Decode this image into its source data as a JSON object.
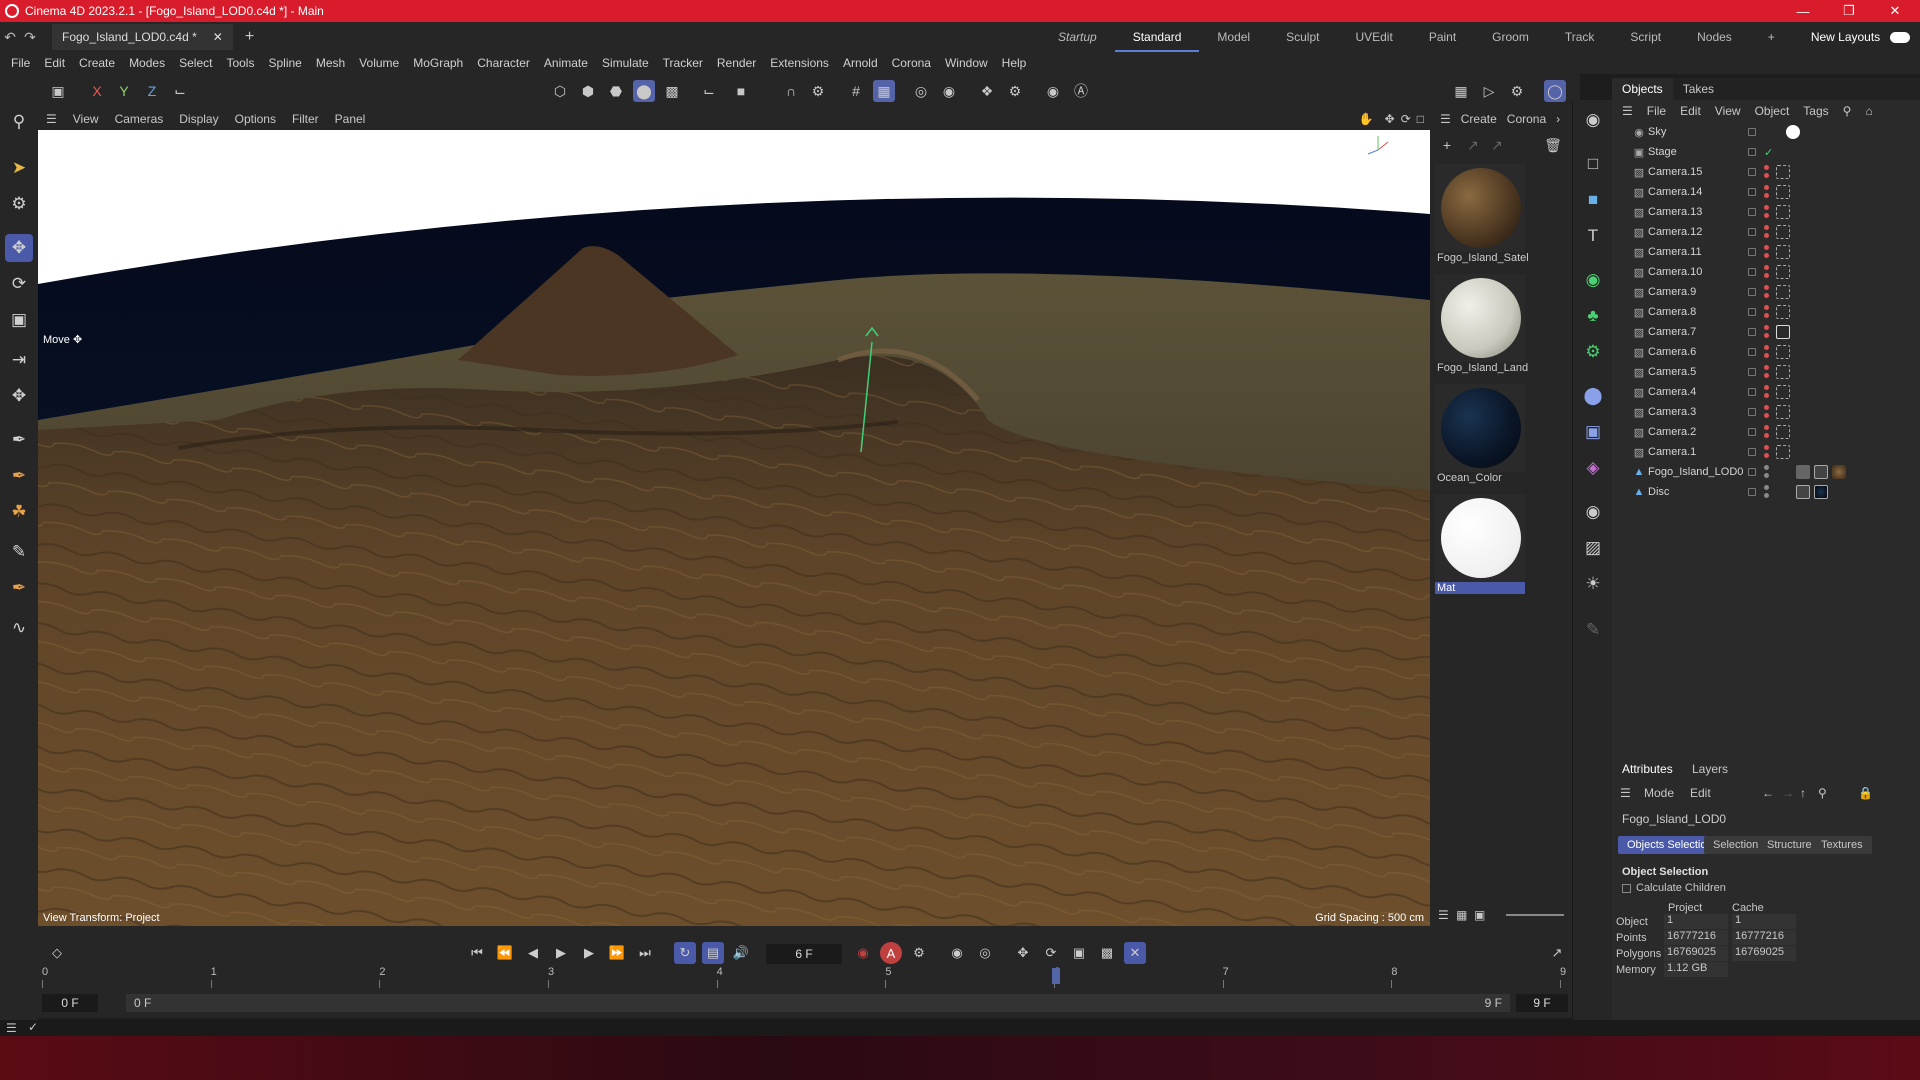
{
  "app": {
    "title": "Cinema 4D 2023.2.1 - [Fogo_Island_LOD0.c4d *] - Main"
  },
  "document": {
    "tab": "Fogo_Island_LOD0.c4d *"
  },
  "layouts": {
    "items": [
      "Startup",
      "Standard",
      "Model",
      "Sculpt",
      "UVEdit",
      "Paint",
      "Groom",
      "Track",
      "Script",
      "Nodes"
    ],
    "active": "Standard",
    "new_layouts": "New Layouts"
  },
  "menu": {
    "items": [
      "File",
      "Edit",
      "Create",
      "Modes",
      "Select",
      "Tools",
      "Spline",
      "Mesh",
      "Volume",
      "MoGraph",
      "Character",
      "Animate",
      "Simulate",
      "Tracker",
      "Render",
      "Extensions",
      "Arnold",
      "Corona",
      "Window",
      "Help"
    ]
  },
  "axes": {
    "x": "X",
    "y": "Y",
    "z": "Z"
  },
  "viewport": {
    "menu": [
      "View",
      "Cameras",
      "Display",
      "Options",
      "Filter",
      "Panel"
    ],
    "mode_label": "Move",
    "view_transform": "View Transform: Project",
    "grid_spacing": "Grid Spacing : 500 cm"
  },
  "materials": {
    "menu": [
      "Create",
      "Corona"
    ],
    "items": [
      {
        "name": "Fogo_Island_Satel"
      },
      {
        "name": "Fogo_Island_Land"
      },
      {
        "name": "Ocean_Color"
      },
      {
        "name": "Mat"
      }
    ]
  },
  "objects": {
    "tabs": [
      "Objects",
      "Takes"
    ],
    "menu": [
      "File",
      "Edit",
      "View",
      "Object",
      "Tags"
    ],
    "items": [
      "Sky",
      "Stage",
      "Camera.15",
      "Camera.14",
      "Camera.13",
      "Camera.12",
      "Camera.11",
      "Camera.10",
      "Camera.9",
      "Camera.8",
      "Camera.7",
      "Camera.6",
      "Camera.5",
      "Camera.4",
      "Camera.3",
      "Camera.2",
      "Camera.1",
      "Fogo_Island_LOD0",
      "Disc"
    ]
  },
  "attributes": {
    "tabs": [
      "Attributes",
      "Layers"
    ],
    "menu": [
      "Mode",
      "Edit"
    ],
    "object_name": "Fogo_Island_LOD0",
    "subtabs": [
      "Objects Selection",
      "Selection",
      "Structure",
      "Textures"
    ],
    "section": "Object Selection",
    "calc_children": "Calculate Children",
    "col_project": "Project",
    "col_cache": "Cache",
    "rows": [
      {
        "label": "Object",
        "project": "1",
        "cache": "1"
      },
      {
        "label": "Points",
        "project": "16777216",
        "cache": "16777216"
      },
      {
        "label": "Polygons",
        "project": "16769025",
        "cache": "16769025"
      },
      {
        "label": "Memory",
        "project": "1.12 GB",
        "cache": ""
      }
    ]
  },
  "timeline": {
    "current_frame": "6 F",
    "start": "0 F",
    "range_start": "0 F",
    "range_end": "9 F",
    "end": "9 F",
    "ticks": [
      "0",
      "1",
      "2",
      "3",
      "4",
      "5",
      "6",
      "7",
      "8",
      "9"
    ],
    "playhead_frame": 6,
    "total_frames": 9
  }
}
